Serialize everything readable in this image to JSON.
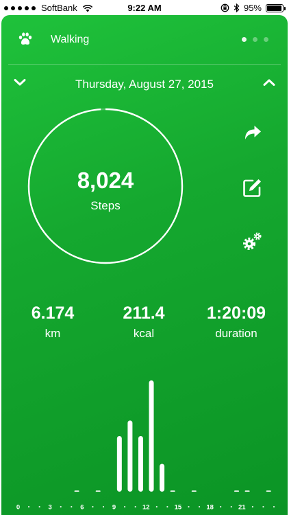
{
  "status_bar": {
    "carrier": "SoftBank",
    "time": "9:22 AM",
    "battery": "95%",
    "battery_level": 0.95
  },
  "header": {
    "activity": "Walking",
    "page_count": 3,
    "active_page": 0
  },
  "date": "Thursday, August 27, 2015",
  "summary": {
    "steps": "8,024",
    "steps_label": "Steps",
    "goal_progress": 0.99
  },
  "stats": {
    "distance": "6.174",
    "distance_unit": "km",
    "calories": "211.4",
    "calories_unit": "kcal",
    "duration": "1:20:09",
    "duration_label": "duration"
  },
  "chart_data": {
    "type": "bar",
    "x_ticks": [
      "0",
      "3",
      "6",
      "9",
      "12",
      "15",
      "18",
      "21"
    ],
    "xlim": [
      0,
      24
    ],
    "ylim": [
      0,
      1
    ],
    "series": [
      {
        "hours": [
          5,
          7,
          9,
          10,
          11,
          12,
          13,
          14,
          16,
          20,
          21,
          23
        ],
        "values": [
          0.01,
          0.01,
          0.5,
          0.64,
          0.5,
          1.0,
          0.25,
          0.01,
          0.01,
          0.01,
          0.01,
          0.01
        ]
      }
    ]
  },
  "colors": {
    "card_top": "#1fc23b",
    "card_bottom": "#0b9425",
    "foreground": "#ffffff"
  }
}
